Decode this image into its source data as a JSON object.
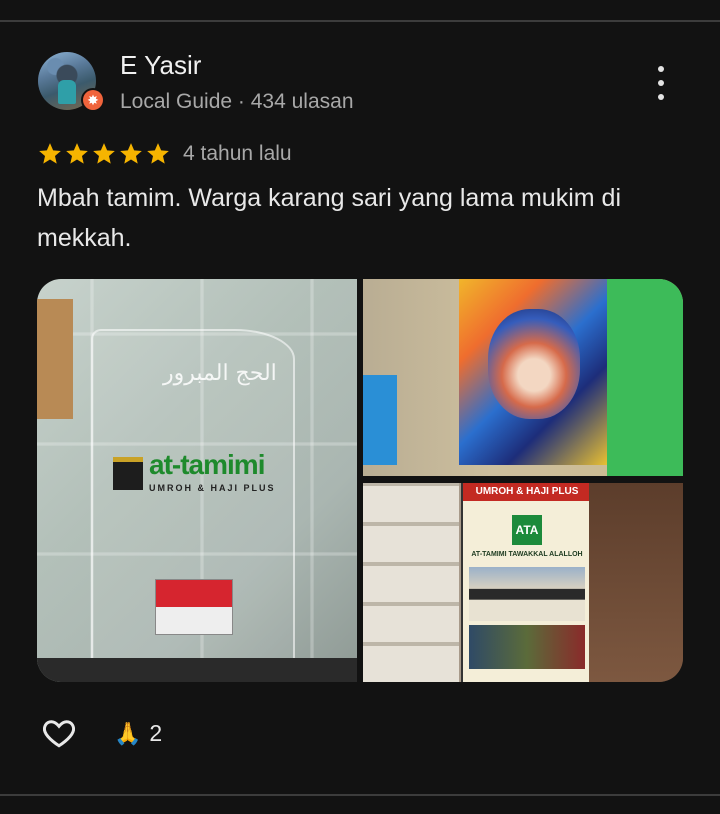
{
  "reviewer": {
    "name": "E Yasir",
    "subtitle": "Local Guide · 434 ulasan",
    "avatar_icon": "avatar",
    "badge_icon": "local-guide-star-badge"
  },
  "rating": {
    "stars": 5,
    "max": 5,
    "color": "#f6b400",
    "time_ago": "4 tahun lalu"
  },
  "review_text": "Mbah tamim. Warga karang sari yang lama mukim di mekkah.",
  "photos": [
    {
      "calligraphy": "الحج المبرور",
      "brand": "at-tamimi",
      "brand_sub": "UMROH & HAJI PLUS"
    },
    {},
    {
      "poster_header": "UMROH & HAJI PLUS",
      "poster_logo": "ATA",
      "poster_title": "AT-TAMIMI TAWAKKAL ALALLOH"
    }
  ],
  "actions": {
    "like_icon": "heart-icon",
    "reaction_icon": "🙏",
    "reaction_count": "2"
  },
  "menu_icon": "more-vert-icon"
}
